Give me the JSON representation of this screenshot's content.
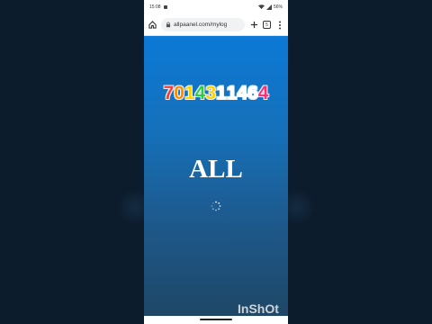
{
  "status_bar": {
    "time": "15:08",
    "battery": "56%"
  },
  "browser": {
    "url": "allpaanel.com/mylog",
    "tab_count": "5"
  },
  "page": {
    "phone_number": "7014311464",
    "phone_digit_colors": [
      "#ff3b30",
      "#ff8c00",
      "#ffd200",
      "#2ecc40",
      "#ffd200",
      "#ffffff",
      "#ffffff",
      "#ffffff",
      "#ffffff",
      "#ff2d75"
    ],
    "brand": "ALL",
    "loading": true
  },
  "watermark": "InShOt",
  "colors": {
    "content_top": "#0c79d6",
    "content_bottom": "#1f4766",
    "background": "#0c1c2d"
  },
  "icons": [
    "home-icon",
    "lock-icon",
    "plus-icon",
    "tabs-icon",
    "more-vert-icon",
    "loading-spinner-icon"
  ]
}
